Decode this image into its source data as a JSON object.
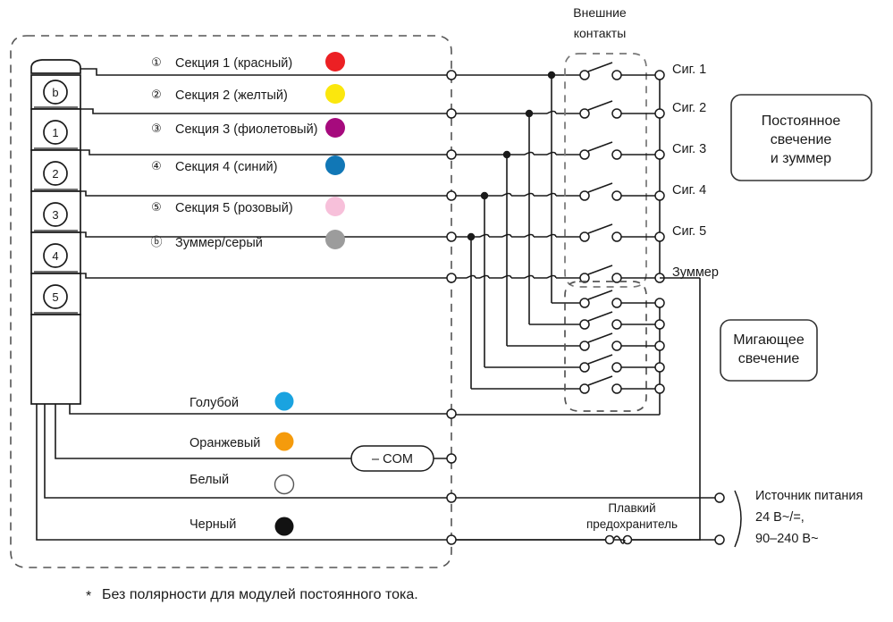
{
  "diagram": {
    "title_external_contacts": "Внешние\nконтакты",
    "external_contacts_line1": "Внешние",
    "external_contacts_line2": "контакты",
    "footnote": "Без полярности для модулей постоянного тока.",
    "footnote_marker": "*"
  },
  "tower": {
    "segments": [
      {
        "id": "b",
        "label": "b"
      },
      {
        "id": "1",
        "label": "1"
      },
      {
        "id": "2",
        "label": "2"
      },
      {
        "id": "3",
        "label": "3"
      },
      {
        "id": "4",
        "label": "4"
      },
      {
        "id": "5",
        "label": "5"
      }
    ]
  },
  "sections": [
    {
      "num": "①",
      "label": "Секция 1 (красный)",
      "color": "#ec2024",
      "signal": "Сиг. 1"
    },
    {
      "num": "②",
      "label": "Секция 2 (желтый)",
      "color": "#fbe70d",
      "signal": "Сиг. 2"
    },
    {
      "num": "③",
      "label": "Секция 3 (фиолетовый)",
      "color": "#a60a7d",
      "signal": "Сиг. 3"
    },
    {
      "num": "④",
      "label": "Секция 4 (синий)",
      "color": "#1177b6",
      "signal": "Сиг. 4"
    },
    {
      "num": "⑤",
      "label": "Секция 5 (розовый)",
      "color": "#f7c0da",
      "signal": "Сиг. 5"
    },
    {
      "num": "ⓑ",
      "label": "Зуммер/серый",
      "color": "#9c9c9c",
      "signal": "Зуммер"
    }
  ],
  "wires": [
    {
      "label": "Голубой",
      "color": "#1aa3e0",
      "filled": true
    },
    {
      "label": "Оранжевый",
      "color": "#f59b0c",
      "filled": true
    },
    {
      "label": "Белый",
      "color": "#ffffff",
      "filled": false
    },
    {
      "label": "Черный",
      "color": "#121212",
      "filled": true
    }
  ],
  "com": {
    "label": "– COM"
  },
  "callouts": [
    {
      "id": "steady",
      "lines": [
        "Постоянное",
        "свечение",
        "и зуммер"
      ]
    },
    {
      "id": "flashing",
      "lines": [
        "Мигающее",
        "свечение"
      ]
    }
  ],
  "fuse": {
    "line1": "Плавкий",
    "line2": "предохранитель"
  },
  "power": {
    "line1": "Источник питания",
    "line2": "24 В~/=,",
    "line3": "90–240 В~"
  },
  "colors": {
    "stroke": "#1a1a1a",
    "dashed": "#555555",
    "group_dashed": "#777777",
    "background": "#ffffff"
  }
}
